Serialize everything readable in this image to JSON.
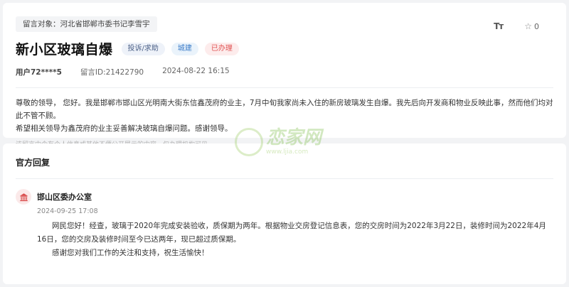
{
  "message": {
    "target_label": "留言对象：",
    "target_name": "河北省邯郸市委书记李雪宇",
    "title": "新小区玻璃自爆",
    "badges": {
      "type": "投诉/求助",
      "category": "城建",
      "status": "已办理"
    },
    "user": "用户72****5",
    "message_id": "留言ID:21422790",
    "timestamp": "2024-08-22 16:15",
    "likes": "0",
    "content_line1": "尊敬的领导， 您好。我是邯郸市邯山区光明南大街东信鑫茂府的业主，7月中旬我家尚未入住的新房玻璃发生自爆。我先后向开发商和物业反映此事，然而他们均对此不管不顾。",
    "content_line2": "希望相关领导为鑫茂府的业主妥善解决玻璃自爆问题。感谢领导。",
    "notice": "该留言中含有个人信息或其他不便公开展示的内容，仅办理机构可见。"
  },
  "reply": {
    "section_title": "官方回复",
    "org_name": "邯山区委办公室",
    "time": "2024-09-25 17:08",
    "para1": "网民您好！经查，玻璃于2020年完成安装验收，质保期为两年。根据物业交房登记信息表，您的交房时间为2022年3月22日，装修时间为2022年4月16日，您的交房及装修时间至今已达两年，现已超过质保期。",
    "para2": "感谢您对我们工作的关注和支持，祝生活愉快！"
  },
  "watermark": {
    "text": "恋家网",
    "url": "www.ljia.com"
  },
  "colors": {
    "status_red": "#e05252",
    "category_blue": "#3a7bc8",
    "type_gray_blue": "#4a5f86"
  },
  "icons": {
    "font_size": "font-size-icon",
    "star": "star-icon",
    "org": "building-icon"
  }
}
